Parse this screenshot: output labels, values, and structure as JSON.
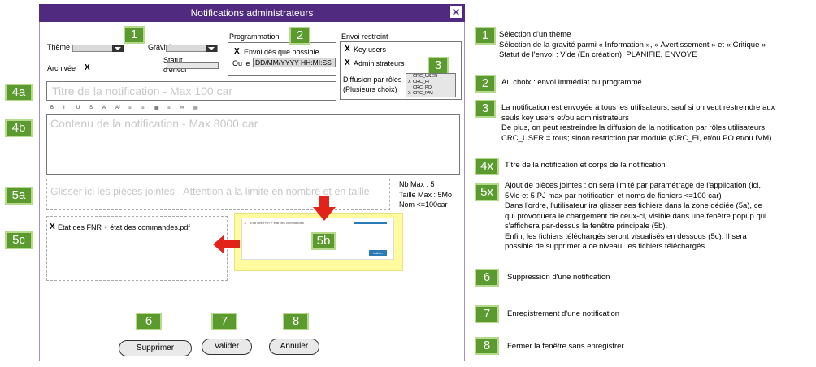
{
  "window": {
    "title": "Notifications administrateurs",
    "close": "✕"
  },
  "form": {
    "theme_label": "Thème",
    "gravite_label": "Gravité",
    "archivee_label": "Archivée",
    "archivee_check": "X",
    "statut_label_1": "Statut",
    "statut_label_2": "d'envoi",
    "programmation_label": "Programmation",
    "envoi_check": "X",
    "envoi_label": "Envoi dès que possible",
    "ou_le_label": "Ou le",
    "date_placeholder": "DD/MM/YYYY HH:MI:SS",
    "envoi_restreint_label": "Envoi restreint",
    "key_users_check": "X",
    "key_users_label": "Key users",
    "admins_check": "X",
    "admins_label": "Administrateurs",
    "diffusion_label_1": "Diffusion par rôles",
    "diffusion_label_2": "(Plusieurs choix)",
    "roles": [
      {
        "check": "",
        "name": "CRC_USER"
      },
      {
        "check": "X",
        "name": "CRC_FI"
      },
      {
        "check": "",
        "name": "CRC_PO"
      },
      {
        "check": "X",
        "name": "CRC_IVM"
      }
    ],
    "title_placeholder": "Titre de la notification - Max 100 car",
    "toolbar": [
      "B",
      "I",
      "U",
      "S",
      "A",
      "A²",
      "≡",
      "≡",
      "▦",
      "≡",
      "∞",
      "▤"
    ],
    "content_placeholder": "Contenu de la notification - Max  8000 car",
    "attach_placeholder": "Glisser ici les pièces jointes - Attention à la limite en nombre et en  taille",
    "limits": [
      "Nb Max : 5",
      "Taille Max : 5Mo",
      "Nom <=100car"
    ],
    "file_check": "X",
    "file_name": "Etat des FNR + état des commandes.pdf",
    "popup_file": "Etat des FNR + état des commandes",
    "popup_btn": "Valider",
    "btn_supprimer": "Supprimer",
    "btn_valider": "Valider",
    "btn_annuler": "Annuler"
  },
  "badges": {
    "b1": "1",
    "b2": "2",
    "b3": "3",
    "b4a": "4a",
    "b4b": "4b",
    "b5a": "5a",
    "b5b": "5b",
    "b5c": "5c",
    "b6": "6",
    "b7": "7",
    "b8": "8"
  },
  "legend": [
    {
      "badge": "1",
      "lines": [
        "Sélection d'un thème",
        "Sélection de la gravité parmi « Information », « Avertissement » et « Critique »",
        "Statut de l'envoi : Vide (En création), PLANIFIE, ENVOYE"
      ]
    },
    {
      "badge": "2",
      "lines": [
        "Au choix : envoi immédiat ou programmé"
      ]
    },
    {
      "badge": "3",
      "lines": [
        "La notification est envoyée à tous les utilisateurs, sauf si on veut restreindre aux",
        "seuls key users et/ou administrateurs",
        "De plus, on peut restreindre la diffusion de la notification par rôles utilisateurs",
        "CRC_USER = tous; sinon restriction par module (CRC_FI, et/ou PO et/ou IVM)"
      ]
    },
    {
      "badge": "4x",
      "lines": [
        "Titre de la notification et corps de la notification"
      ]
    },
    {
      "badge": "5x",
      "lines": [
        "Ajout de pièces jointes : on sera limité par paramétrage de l'application (ici,",
        "5Mo et 5 PJ max par notification et noms de fichiers <=100 car)",
        "Dans l'ordre, l'utilisateur ira glisser ses fichiers dans la zone dédiée (5a), ce",
        "qui provoquera le chargement de ceux-ci, visible dans une fenêtre popup qui",
        "s'affichera par-dessus la fenêtre principale (5b).",
        "Enfin, les fichiers téléchargés seront visualisés en dessous (5c). Il sera",
        "possible de supprimer à ce niveau, les fichiers téléchargés"
      ]
    },
    {
      "badge": "6",
      "lines": [
        "Suppression d'une notification"
      ]
    },
    {
      "badge": "7",
      "lines": [
        "Enregistrement d'une notification"
      ]
    },
    {
      "badge": "8",
      "lines": [
        "Fermer la fenêtre sans enregistrer"
      ]
    }
  ],
  "colors": {
    "title_bar": "#4f2a7e",
    "badge_green": "#5a9a2e",
    "arrow_red": "#e2231a",
    "popup_yellow": "#fffb9e"
  }
}
